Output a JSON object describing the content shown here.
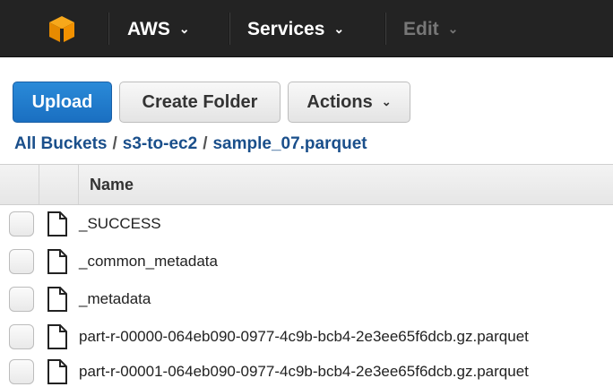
{
  "nav": {
    "logo_icon": "aws-cube-icon",
    "items": [
      {
        "label": "AWS",
        "caret": "⌄",
        "disabled": false
      },
      {
        "label": "Services",
        "caret": "⌄",
        "disabled": false
      },
      {
        "label": "Edit",
        "caret": "⌄",
        "disabled": true
      }
    ]
  },
  "toolbar": {
    "upload_label": "Upload",
    "create_folder_label": "Create Folder",
    "actions_label": "Actions",
    "actions_caret": "⌄"
  },
  "breadcrumb": {
    "items": [
      "All Buckets",
      "s3-to-ec2",
      "sample_07.parquet"
    ],
    "separator": "/"
  },
  "table": {
    "header_name": "Name",
    "rows": [
      {
        "name": "_SUCCESS",
        "icon": "file-icon"
      },
      {
        "name": "_common_metadata",
        "icon": "file-icon"
      },
      {
        "name": "_metadata",
        "icon": "file-icon"
      },
      {
        "name": "part-r-00000-064eb090-0977-4c9b-bcb4-2e3ee65f6dcb.gz.parquet",
        "icon": "file-icon"
      },
      {
        "name": "part-r-00001-064eb090-0977-4c9b-bcb4-2e3ee65f6dcb.gz.parquet",
        "icon": "file-icon"
      }
    ]
  },
  "colors": {
    "topbar": "#232323",
    "primary": "#1a6fc1",
    "link": "#1a4f8b",
    "logo": "#f29100"
  }
}
